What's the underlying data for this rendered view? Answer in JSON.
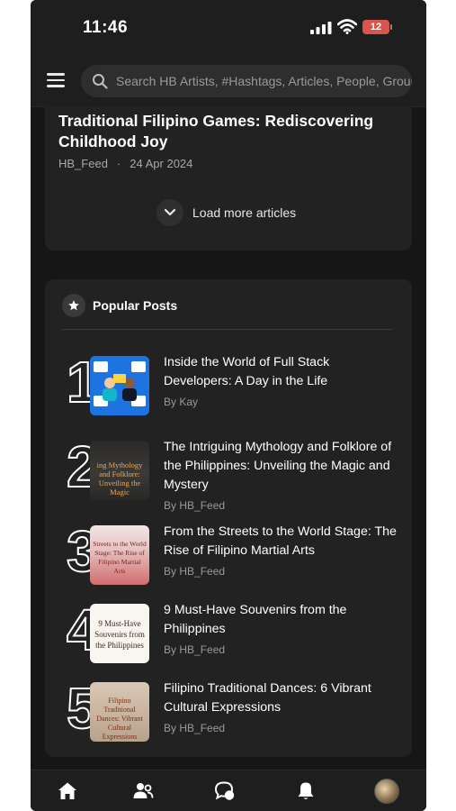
{
  "status_bar": {
    "time": "11:46",
    "battery": "12"
  },
  "header": {
    "search_placeholder": "Search HB Artists, #Hashtags, Articles, People, Groups"
  },
  "last_article": {
    "title": "Traditional Filipino Games: Rediscovering Childhood Joy",
    "author": "HB_Feed",
    "separator": "·",
    "date": "24 Apr 2024"
  },
  "load_more": {
    "label": "Load more articles"
  },
  "popular": {
    "heading": "Popular Posts",
    "posts": [
      {
        "rank": "1",
        "title": "Inside the World of Full Stack Developers: A Day in the Life",
        "by": "By",
        "author": "Kay"
      },
      {
        "rank": "2",
        "title": "The Intriguing Mythology and Folklore of the Philippines: Unveiling the Magic and Mystery",
        "by": "By",
        "author": "HB_Feed"
      },
      {
        "rank": "3",
        "title": "From the Streets to the World Stage: The Rise of Filipino Martial Arts",
        "by": "By",
        "author": "HB_Feed"
      },
      {
        "rank": "4",
        "title": "9 Must-Have Souvenirs from the Philippines",
        "by": "By",
        "author": "HB_Feed"
      },
      {
        "rank": "5",
        "title": "Filipino Traditional Dances: 6 Vibrant Cultural Expressions",
        "by": "By",
        "author": "HB_Feed"
      }
    ]
  },
  "thumb_text": {
    "t2": "ing Mythology and Folklore: Unveiling the Magic",
    "t3": "Streets to the World Stage: The Rise of Filipino Martial Arts",
    "t4": "9 Must-Have Souvenirs from the Philippines",
    "t5": "Filipino Traditional Dances: Vibrant Cultural Expressions"
  },
  "icons": {
    "menu": "hamburger-icon",
    "search": "search-icon",
    "load": "chevron-down-icon",
    "star": "star-icon",
    "nav": [
      "home-icon",
      "people-icon",
      "chat-icon",
      "bell-icon",
      "avatar"
    ]
  },
  "colors": {
    "background": "#161616",
    "card": "#222222",
    "text": "#ffffff",
    "muted": "#9a9a9a",
    "battery": "#d9534f"
  }
}
